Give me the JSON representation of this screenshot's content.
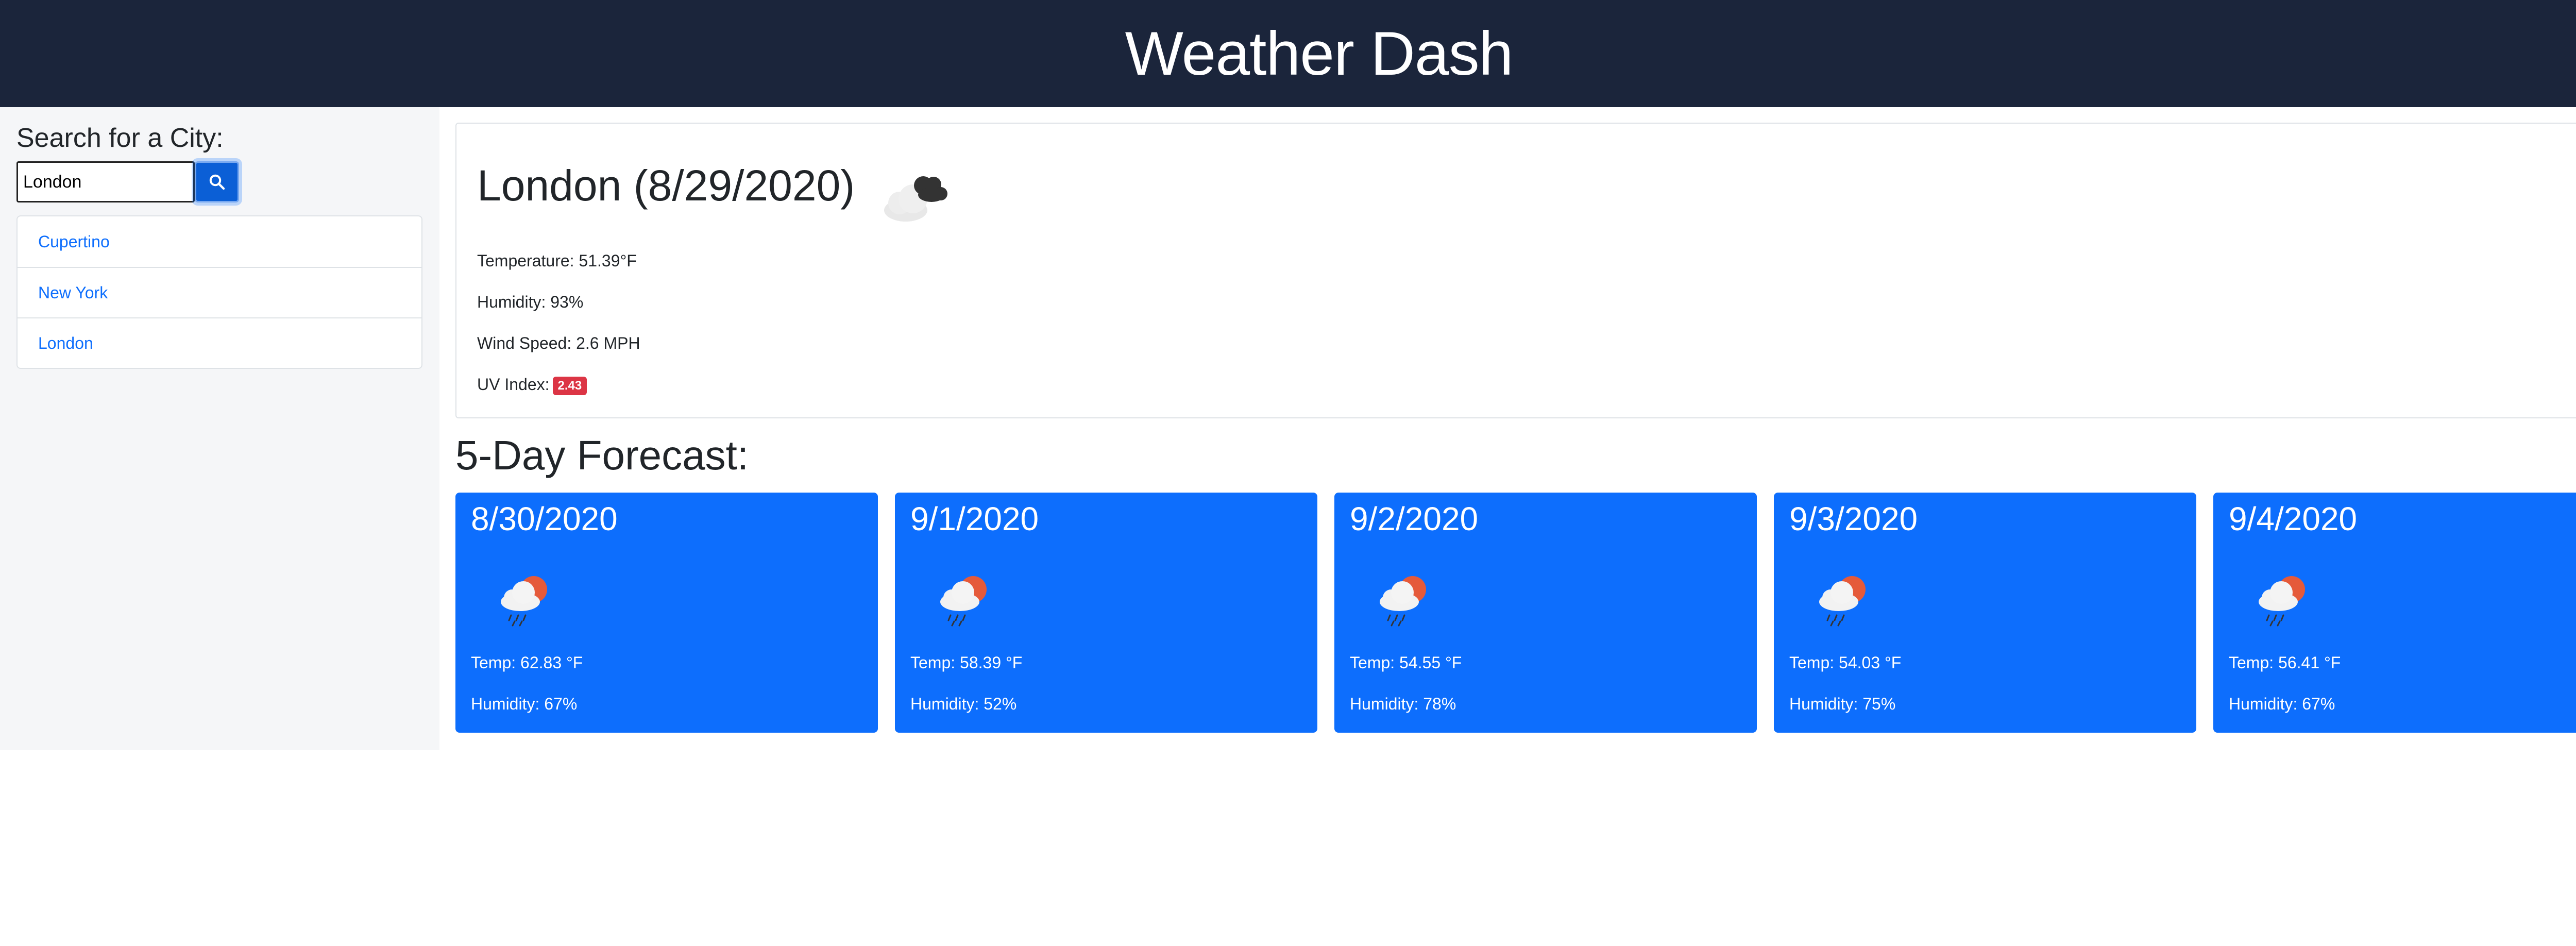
{
  "header": {
    "title": "Weather Dash"
  },
  "sidebar": {
    "search_label": "Search for a City:",
    "search_value": "London",
    "search_button_icon": "search-icon",
    "history": [
      "Cupertino",
      "New York",
      "London"
    ]
  },
  "current": {
    "title": "London (8/29/2020)",
    "icon": "cloudy-icon",
    "temperature": "Temperature: 51.39°F",
    "humidity": "Humidity: 93%",
    "wind": "Wind Speed: 2.6 MPH",
    "uv_label": "UV Index:",
    "uv_value": "2.43",
    "uv_color": "#dc3545"
  },
  "forecast": {
    "heading": "5-Day Forecast:",
    "card_color": "#0d6efd",
    "days": [
      {
        "date": "8/30/2020",
        "icon": "rain-sun-icon",
        "temp": "Temp: 62.83 °F",
        "humidity": "Humidity: 67%"
      },
      {
        "date": "9/1/2020",
        "icon": "rain-sun-icon",
        "temp": "Temp: 58.39 °F",
        "humidity": "Humidity: 52%"
      },
      {
        "date": "9/2/2020",
        "icon": "rain-sun-icon",
        "temp": "Temp: 54.55 °F",
        "humidity": "Humidity: 78%"
      },
      {
        "date": "9/3/2020",
        "icon": "rain-sun-icon",
        "temp": "Temp: 54.03 °F",
        "humidity": "Humidity: 75%"
      },
      {
        "date": "9/4/2020",
        "icon": "rain-sun-icon",
        "temp": "Temp: 56.41 °F",
        "humidity": "Humidity: 67%"
      }
    ]
  }
}
